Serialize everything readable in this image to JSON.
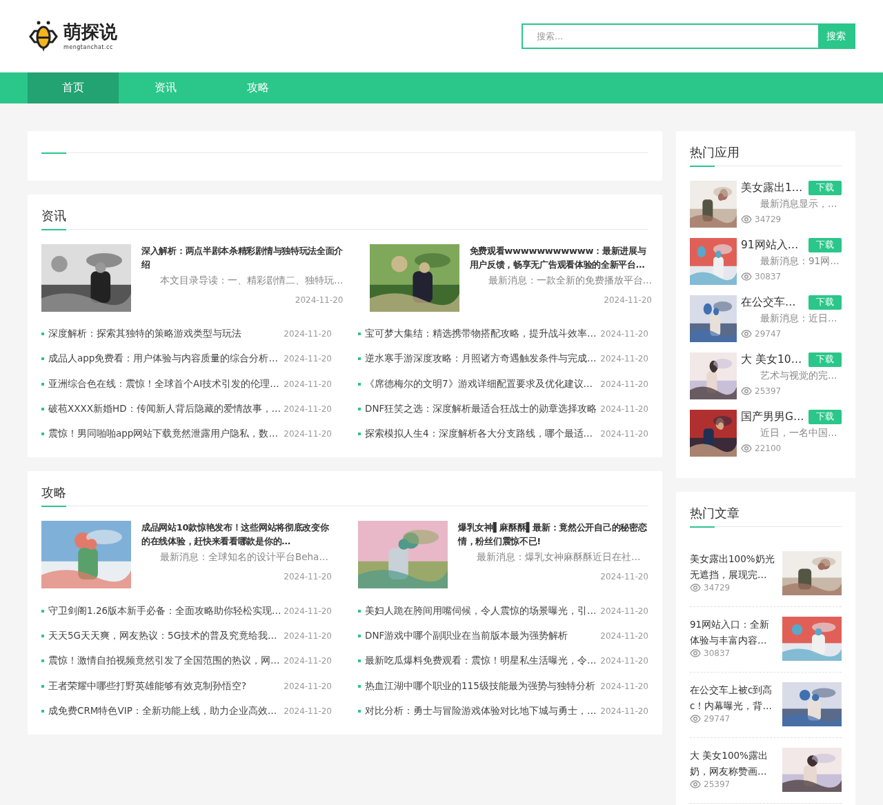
{
  "header": {
    "logo_title": "萌探说",
    "logo_domain": "mengtanchat.cc",
    "search": {
      "placeholder": "搜索...",
      "button": "搜索"
    }
  },
  "nav": [
    {
      "label": "首页",
      "selected": true
    },
    {
      "label": "资讯",
      "selected": false
    },
    {
      "label": "攻略",
      "selected": false
    }
  ],
  "sections": [
    {
      "title": "资讯",
      "featured": [
        {
          "title": "深入解析：两点半剧本杀精彩剧情与独特玩法全面介绍",
          "summary": "本文目录导读：一、精彩剧情二、独特玩…",
          "date": "2024-11-20"
        },
        {
          "title": "免费观看wwwwwwwwwww：最新进展与用户反馈，畅享无广告观看体验的全新平台…",
          "summary": "最新消息：一款全新的免费播放平台…",
          "date": "2024-11-20"
        }
      ],
      "items": [
        {
          "title": "深度解析：探索其独特的策略游戏类型与玩法",
          "date": "2024-11-20"
        },
        {
          "title": "宝可梦大集结：精选携带物搭配攻略，提升战斗效率…",
          "date": "2024-11-20"
        },
        {
          "title": "成品人app免费看：用户体验与内容质量的综合分析…",
          "date": "2024-11-20"
        },
        {
          "title": "逆水寒手游深度攻略：月照诸方奇遇触发条件与完成…",
          "date": "2024-11-20"
        },
        {
          "title": "亚洲综合色在线：震惊！全球首个AI技术引发的伦理…",
          "date": "2024-11-20"
        },
        {
          "title": "《席德梅尔的文明7》游戏详细配置要求及优化建议…",
          "date": "2024-11-20"
        },
        {
          "title": "破苞XXXX新婚HD：传闻新人背后隐藏的爱情故事，…",
          "date": "2024-11-20"
        },
        {
          "title": "DNF狂笑之选：深度解析最适合狂战士的勋章选择攻略",
          "date": "2024-11-20"
        },
        {
          "title": "震惊！男同啪啪app网站下载竟然泄露用户隐私，数…",
          "date": "2024-11-20"
        },
        {
          "title": "探索模拟人生4：深度解析各大分支路线，哪个最适…",
          "date": "2024-11-20"
        }
      ]
    },
    {
      "title": "攻略",
      "featured": [
        {
          "title": "成品网站10款惊艳发布！这些网站将彻底改变你的在线体验，赶快来看看哪款是你的…",
          "summary": "最新消息：全球知名的设计平台Beha…",
          "date": "2024-11-20"
        },
        {
          "title": "爆乳女神▌麻酥酥▌最新：竟然公开自己的秘密恋情，粉丝们震惊不已!",
          "summary": "最新消息：爆乳女神麻酥酥近日在社…",
          "date": "2024-11-20"
        }
      ],
      "items": [
        {
          "title": "守卫剑阁1.26版本新手必备：全面攻略助你轻松实现…",
          "date": "2024-11-20"
        },
        {
          "title": "美妇人跪在胯间用嘴伺候，令人震惊的场景曝光，引…",
          "date": "2024-11-20"
        },
        {
          "title": "天天5G天天爽，网友热议：5G技术的普及究竟给我…",
          "date": "2024-11-20"
        },
        {
          "title": "DNF游戏中哪个副职业在当前版本最为强势解析",
          "date": "2024-11-20"
        },
        {
          "title": "震惊！激情自拍视频竟然引发了全国范围的热议，网…",
          "date": "2024-11-20"
        },
        {
          "title": "最新吃瓜爆料免费观看：震惊！明星私生活曝光，令…",
          "date": "2024-11-20"
        },
        {
          "title": "王者荣耀中哪些打野英雄能够有效克制孙悟空?",
          "date": "2024-11-20"
        },
        {
          "title": "热血江湖中哪个职业的115级技能最为强势与独特分析",
          "date": "2024-11-20"
        },
        {
          "title": "成免费CRM特色VIP：全新功能上线，助力企业高效…",
          "date": "2024-11-20"
        },
        {
          "title": "对比分析：勇士与冒险游戏体验对比地下城与勇士，…",
          "date": "2024-11-20"
        }
      ]
    }
  ],
  "hot_apps": {
    "title": "热门应用",
    "items": [
      {
        "name": "美女露出1…",
        "button": "下载",
        "summary": "最新消息显示，…",
        "views": "34729"
      },
      {
        "name": "91网站入…",
        "button": "下载",
        "summary": "最新消息：91网…",
        "views": "30837"
      },
      {
        "name": "在公交车…",
        "button": "下载",
        "summary": "最新消息：近日…",
        "views": "29747"
      },
      {
        "name": "大 美女10…",
        "button": "下载",
        "summary": "艺术与视觉的完…",
        "views": "25397"
      },
      {
        "name": "国产男男G…",
        "button": "下载",
        "summary": "近日，一名中国…",
        "views": "22100"
      }
    ]
  },
  "hot_articles": {
    "title": "热门文章",
    "items": [
      {
        "title": "美女露出100%奶光无遮挡，展现完…",
        "views": "34729"
      },
      {
        "title": "91网站入口：全新体验与丰富内容…",
        "views": "30837"
      },
      {
        "title": "在公交车上被c到高c！内幕曝光，背…",
        "views": "29747"
      },
      {
        "title": "大 美女100%露出奶，网友称赞画…",
        "views": "25397"
      }
    ]
  }
}
